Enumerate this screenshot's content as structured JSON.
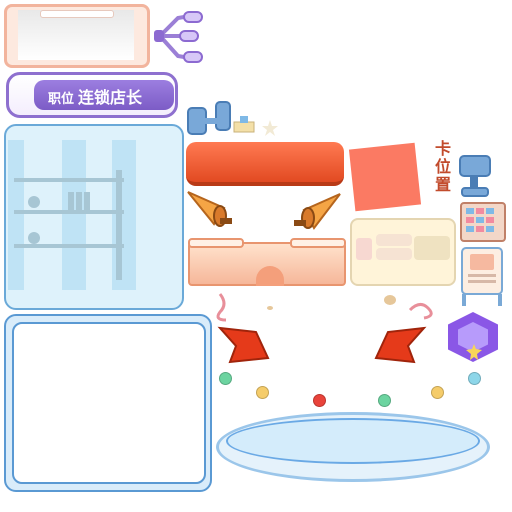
{
  "title_plaque": {
    "label_small": "职位",
    "label_main": "连锁店长"
  },
  "vertical_sign": {
    "text": "卡位置"
  },
  "colors": {
    "accent_purple": "#8e70cf",
    "accent_red": "#e24a22",
    "panel_blue": "#5a99d3"
  },
  "icons": {
    "lamp": "lamp-icon",
    "speaker_left": "megaphone-icon",
    "speaker_right": "megaphone-icon",
    "gem": "gem-star-icon",
    "ribbon_left": "ribbon-icon",
    "ribbon_right": "ribbon-icon"
  }
}
